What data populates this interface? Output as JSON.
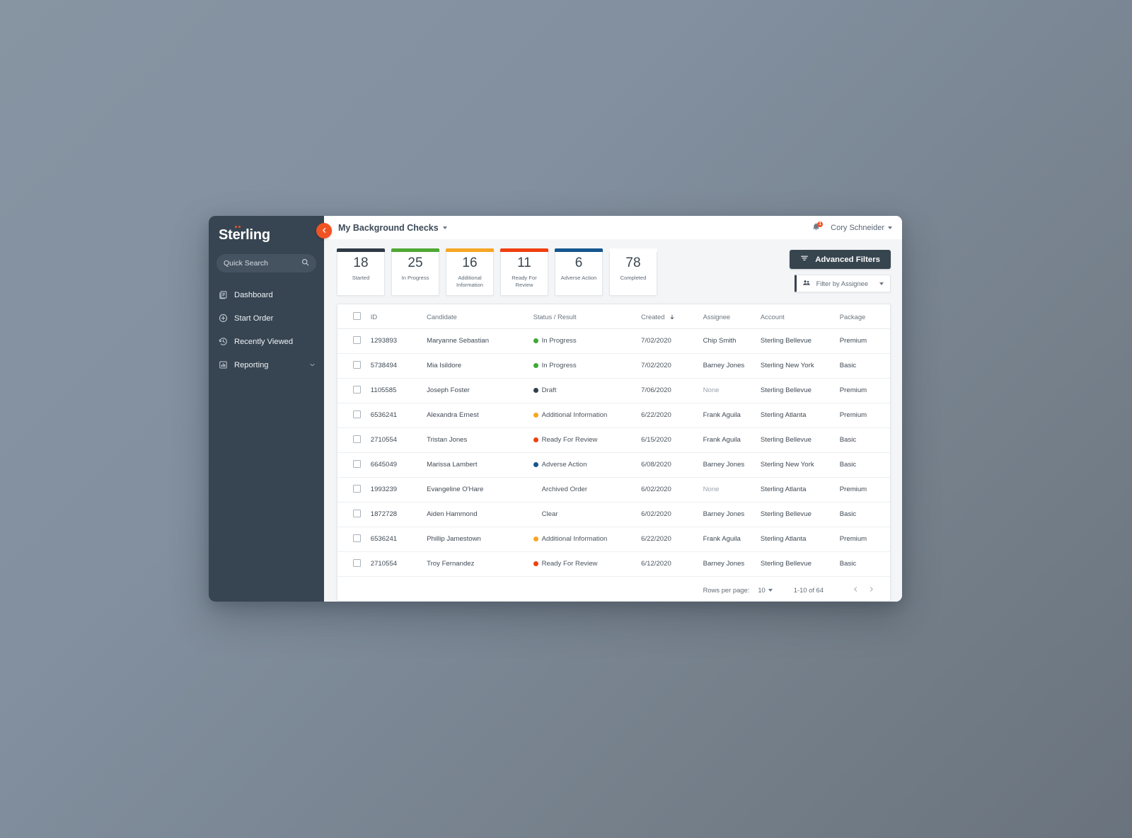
{
  "sidebar": {
    "logo_text": "Sterling",
    "search": {
      "placeholder": "Quick Search",
      "icon": "search-icon"
    },
    "items": [
      {
        "label": "Dashboard",
        "icon": "dashboard-icon"
      },
      {
        "label": "Start Order",
        "icon": "plus-circle-icon"
      },
      {
        "label": "Recently Viewed",
        "icon": "history-clock-icon"
      },
      {
        "label": "Reporting",
        "icon": "bar-chart-icon",
        "expandable": true
      }
    ],
    "collapse_icon": "chevron-left-icon",
    "bg_color": "#374552",
    "accent_color": "#f05323"
  },
  "topbar": {
    "title": "My Background Checks",
    "title_caret_icon": "caret-down-icon",
    "notification": {
      "icon": "bell-icon",
      "badge": "1"
    },
    "user": {
      "name": "Cory Schneider",
      "caret_icon": "caret-down-icon"
    }
  },
  "stats": [
    {
      "value": "18",
      "label": "Started",
      "color": "#2e3a46"
    },
    {
      "value": "25",
      "label": "In Progress",
      "color": "#4fa833"
    },
    {
      "value": "16",
      "label": "Additional Information",
      "color": "#f5a623"
    },
    {
      "value": "11",
      "label": "Ready For Review",
      "color": "#f0400f"
    },
    {
      "value": "6",
      "label": "Adverse Action",
      "color": "#15568f"
    },
    {
      "value": "78",
      "label": "Completed",
      "color": "#ffffff"
    }
  ],
  "filters": {
    "advanced_label": "Advanced Filters",
    "advanced_icon": "filter-icon",
    "assignee_label": "Filter by Assignee",
    "assignee_icon": "people-icon",
    "assignee_caret_icon": "caret-down-icon"
  },
  "table": {
    "columns": [
      "",
      "ID",
      "Candidate",
      "Status / Result",
      "Created",
      "Assignee",
      "Account",
      "Package"
    ],
    "sorted_column": "Created",
    "sort_direction": "desc",
    "sort_icon": "arrow-down-icon",
    "select_all_checkbox": "unchecked",
    "rows": [
      {
        "id": "1293893",
        "candidate": "Maryanne Sebastian",
        "status": "In Progress",
        "status_color": "#3daa35",
        "created": "7/02/2020",
        "assignee": "Chip Smith",
        "assignee_muted": false,
        "account": "Sterling Bellevue",
        "package": "Premium"
      },
      {
        "id": "5738494",
        "candidate": "Mia Isildore",
        "status": "In Progress",
        "status_color": "#3daa35",
        "created": "7/02/2020",
        "assignee": "Barney Jones",
        "assignee_muted": false,
        "account": "Sterling New York",
        "package": "Basic"
      },
      {
        "id": "1105585",
        "candidate": "Joseph Foster",
        "status": "Draft",
        "status_color": "#313f4b",
        "created": "7/06/2020",
        "assignee": "None",
        "assignee_muted": true,
        "account": "Sterling Bellevue",
        "package": "Premium"
      },
      {
        "id": "6536241",
        "candidate": "Alexandra Ernest",
        "status": "Additional Information",
        "status_color": "#f5a623",
        "created": "6/22/2020",
        "assignee": "Frank Aguila",
        "assignee_muted": false,
        "account": "Sterling Atlanta",
        "package": "Premium"
      },
      {
        "id": "2710554",
        "candidate": "Tristan Jones",
        "status": "Ready For Review",
        "status_color": "#f0400f",
        "created": "6/15/2020",
        "assignee": "Frank Aguila",
        "assignee_muted": false,
        "account": "Sterling Bellevue",
        "package": "Basic"
      },
      {
        "id": "6645049",
        "candidate": "Marissa Lambert",
        "status": "Adverse Action",
        "status_color": "#15568f",
        "created": "6/08/2020",
        "assignee": "Barney Jones",
        "assignee_muted": false,
        "account": "Sterling New York",
        "package": "Basic"
      },
      {
        "id": "1993239",
        "candidate": "Evangeline O'Hare",
        "status": "Archived Order",
        "status_color": "",
        "created": "6/02/2020",
        "assignee": "None",
        "assignee_muted": true,
        "account": "Sterling Atlanta",
        "package": "Premium"
      },
      {
        "id": "1872728",
        "candidate": "Aiden Hammond",
        "status": "Clear",
        "status_color": "",
        "created": "6/02/2020",
        "assignee": "Barney Jones",
        "assignee_muted": false,
        "account": "Sterling Bellevue",
        "package": "Basic"
      },
      {
        "id": "6536241",
        "candidate": "Phillip Jamestown",
        "status": "Additional Information",
        "status_color": "#f5a623",
        "created": "6/22/2020",
        "assignee": "Frank Aguila",
        "assignee_muted": false,
        "account": "Sterling Atlanta",
        "package": "Premium"
      },
      {
        "id": "2710554",
        "candidate": "Troy Fernandez",
        "status": "Ready For Review",
        "status_color": "#f0400f",
        "created": "6/12/2020",
        "assignee": "Barney Jones",
        "assignee_muted": false,
        "account": "Sterling Bellevue",
        "package": "Basic"
      }
    ]
  },
  "pagination": {
    "rows_per_page_label": "Rows per page:",
    "rows_per_page_value": "10",
    "range_label": "1-10 of 64",
    "prev_icon": "chevron-left-icon",
    "next_icon": "chevron-right-icon"
  }
}
